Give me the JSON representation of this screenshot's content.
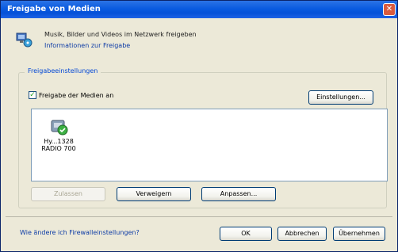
{
  "window": {
    "title": "Freigabe von Medien",
    "close_glyph": "✕"
  },
  "header": {
    "description": "Musik, Bilder und Videos im Netzwerk freigeben",
    "info_link": "Informationen zur Freigabe"
  },
  "group": {
    "legend": "Freigabeeinstellungen",
    "share_checkbox_label": "Freigabe der Medien an",
    "share_checked": true,
    "settings_button": "Einstellungen..."
  },
  "devices": [
    {
      "name_line1": "Hy...1328",
      "name_line2": "RADIO 700"
    }
  ],
  "device_buttons": {
    "allow": "Zulassen",
    "deny": "Verweigern",
    "customize": "Anpassen..."
  },
  "footer": {
    "link": "Wie ändere ich Firewalleinstellungen?",
    "ok": "OK",
    "cancel": "Abbrechen",
    "apply": "Übernehmen"
  }
}
